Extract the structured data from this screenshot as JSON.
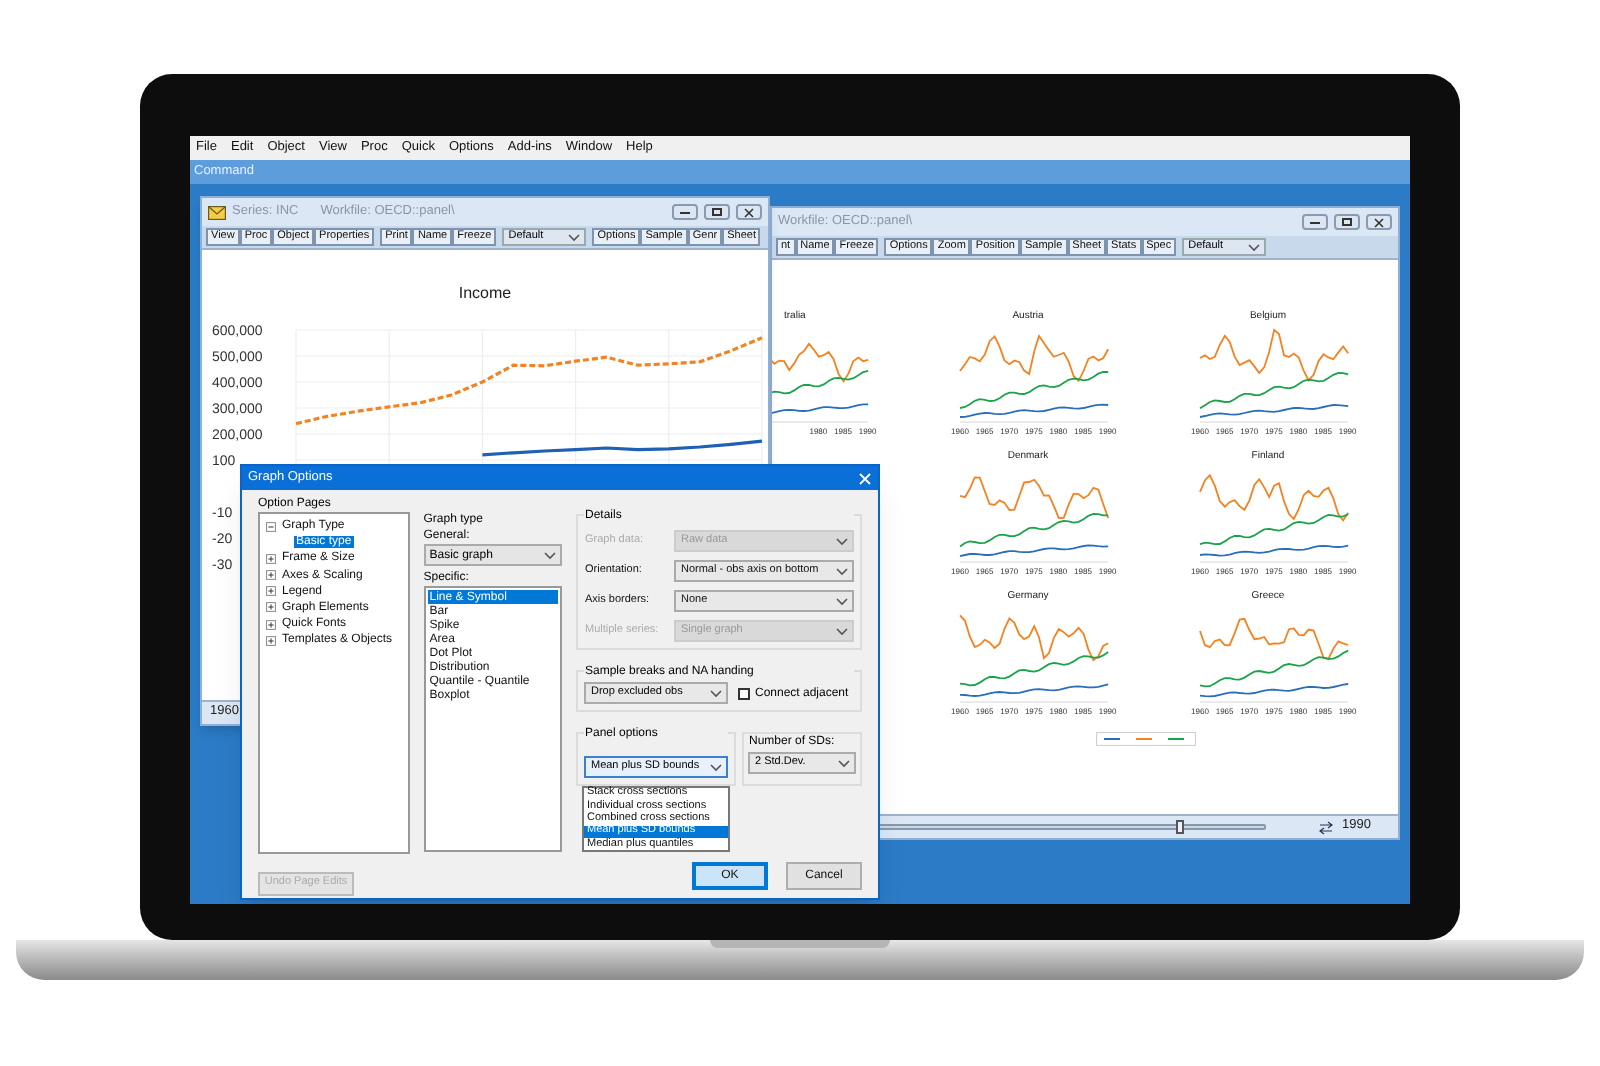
{
  "menu": [
    "File",
    "Edit",
    "Object",
    "View",
    "Proc",
    "Quick",
    "Options",
    "Add-ins",
    "Window",
    "Help"
  ],
  "command_bar": {
    "label": "Command"
  },
  "series_window": {
    "title": "Series: INC",
    "workfile": "Workfile: OECD::panel\\",
    "toolbar_groups": [
      [
        "View",
        "Proc",
        "Object",
        "Properties"
      ],
      [
        "Print",
        "Name",
        "Freeze"
      ],
      [
        "Options",
        "Sample",
        "Genr",
        "Sheet"
      ]
    ],
    "view_select": "Default",
    "chart_data": {
      "type": "line",
      "title": "Income",
      "grid": true,
      "ylim": [
        -300000,
        600000
      ],
      "yticks": [
        {
          "value": 600000,
          "label": "600,000"
        },
        {
          "value": 500000,
          "label": "500,000"
        },
        {
          "value": 400000,
          "label": "400,000"
        },
        {
          "value": 300000,
          "label": "300,000"
        },
        {
          "value": 200000,
          "label": "200,000"
        }
      ],
      "series": [
        {
          "color": "#f58220",
          "line_style": "dashed",
          "values": [
            240000,
            268000,
            288000,
            305000,
            320000,
            350000,
            400000,
            465000,
            462000,
            480000,
            495000,
            465000,
            470000,
            478000,
            520000,
            570000
          ]
        },
        {
          "color": "#1f5fb4",
          "line_style": "solid",
          "values": [
            null,
            null,
            null,
            null,
            null,
            null,
            120000,
            128000,
            135000,
            140000,
            146000,
            140000,
            143000,
            150000,
            160000,
            172000
          ]
        }
      ]
    },
    "cut_tick_labels": [
      "100",
      "-10",
      "-20",
      "-30"
    ],
    "status": "1960"
  },
  "panel_window": {
    "workfile": "Workfile: OECD::panel\\",
    "toolbar_groups": [
      [
        "nt",
        "Name",
        "Freeze"
      ],
      [
        "Options",
        "Zoom",
        "Position",
        "Sample",
        "Sheet",
        "Stats",
        "Spec"
      ]
    ],
    "view_select": "Default",
    "panel_rows": [
      {
        "partial": {
          "title": "tralia",
          "x_ticks": [
            "1980",
            "1985",
            "1990"
          ]
        },
        "panels": [
          {
            "title": "Austria",
            "x_ticks": [
              "1960",
              "1965",
              "1970",
              "1975",
              "1980",
              "1985",
              "1990"
            ]
          },
          {
            "title": "Belgium",
            "x_ticks": [
              "1960",
              "1965",
              "1970",
              "1975",
              "1980",
              "1985",
              "1990"
            ]
          }
        ]
      },
      {
        "panels": [
          {
            "title": "Denmark",
            "x_ticks": [
              "1960",
              "1965",
              "1970",
              "1975",
              "1980",
              "1985",
              "1990"
            ]
          },
          {
            "title": "Finland",
            "x_ticks": [
              "1960",
              "1965",
              "1970",
              "1975",
              "1980",
              "1985",
              "1990"
            ]
          }
        ]
      },
      {
        "panels": [
          {
            "title": "Germany",
            "x_ticks": [
              "1960",
              "1965",
              "1970",
              "1975",
              "1980",
              "1985",
              "1990"
            ]
          },
          {
            "title": "Greece",
            "x_ticks": [
              "1960",
              "1965",
              "1970",
              "1975",
              "1980",
              "1985",
              "1990"
            ]
          }
        ]
      }
    ],
    "slider": {
      "level": 0.82,
      "end_label": "1990"
    }
  },
  "dialog": {
    "title": "Graph Options",
    "option_pages_label": "Option Pages",
    "tree": [
      {
        "label": "Graph Type",
        "expanded": true,
        "selected": false,
        "children": [
          {
            "label": "Basic type",
            "selected": true
          }
        ]
      },
      {
        "label": "Frame & Size",
        "expanded": false,
        "selected": false
      },
      {
        "label": "Axes & Scaling",
        "expanded": false,
        "selected": false
      },
      {
        "label": "Legend",
        "expanded": false,
        "selected": false
      },
      {
        "label": "Graph Elements",
        "expanded": false,
        "selected": false
      },
      {
        "label": "Quick Fonts",
        "expanded": false,
        "selected": false
      },
      {
        "label": "Templates & Objects",
        "expanded": false,
        "selected": false
      }
    ],
    "graph_type": {
      "label": "Graph type",
      "general_label": "General:",
      "general_value": "Basic graph",
      "specific_label": "Specific:",
      "specific": [
        {
          "label": "Line & Symbol",
          "selected": true
        },
        {
          "label": "Bar",
          "selected": false
        },
        {
          "label": "Spike",
          "selected": false
        },
        {
          "label": "Area",
          "selected": false
        },
        {
          "label": "Dot Plot",
          "selected": false
        },
        {
          "label": "Distribution",
          "selected": false
        },
        {
          "label": "Quantile - Quantile",
          "selected": false
        },
        {
          "label": "Boxplot",
          "selected": false
        }
      ]
    },
    "details": {
      "label": "Details",
      "rows": [
        {
          "label": "Graph data:",
          "value": "Raw data",
          "disabled": true
        },
        {
          "label": "Orientation:",
          "value": "Normal - obs axis on bottom",
          "disabled": false
        },
        {
          "label": "Axis borders:",
          "value": "None",
          "disabled": false
        },
        {
          "label": "Multiple series:",
          "value": "Single graph",
          "disabled": true
        }
      ]
    },
    "sample_breaks": {
      "label": "Sample breaks and NA handing",
      "value": "Drop excluded obs",
      "checkbox": {
        "label": "Connect adjacent",
        "checked": false
      }
    },
    "panel_options": {
      "label": "Panel options",
      "value": "Mean plus SD bounds",
      "options": [
        {
          "label": "Stack cross sections",
          "selected": false
        },
        {
          "label": "Individual cross sections",
          "selected": false
        },
        {
          "label": "Combined cross sections",
          "selected": false
        },
        {
          "label": "Mean plus SD bounds",
          "selected": true
        },
        {
          "label": "Median plus quantiles",
          "selected": false
        }
      ],
      "sds_label": "Number of SDs:",
      "sds_value": "2 Std.Dev."
    },
    "buttons": [
      {
        "label": "Undo Page Edits",
        "disabled": true,
        "focused": false
      },
      {
        "label": "OK",
        "disabled": false,
        "focused": true
      },
      {
        "label": "Cancel",
        "disabled": false,
        "focused": false
      }
    ]
  }
}
